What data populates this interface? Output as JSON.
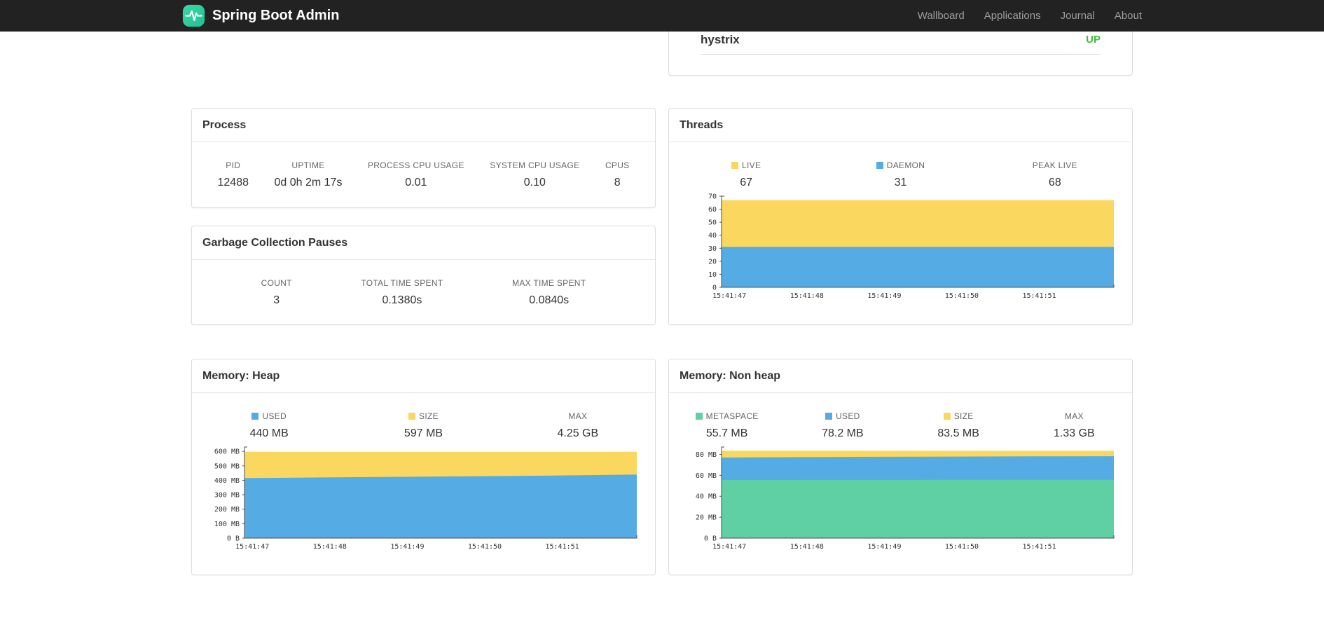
{
  "navbar": {
    "brand": "Spring Boot Admin",
    "items": [
      {
        "label": "Wallboard"
      },
      {
        "label": "Applications"
      },
      {
        "label": "Journal"
      },
      {
        "label": "About"
      }
    ]
  },
  "health": {
    "service_name": "hystrix",
    "status": "UP",
    "status_color": "#44b944"
  },
  "process": {
    "title": "Process",
    "stats": [
      {
        "label": "PID",
        "value": "12488"
      },
      {
        "label": "UPTIME",
        "value": "0d 0h 2m 17s"
      },
      {
        "label": "PROCESS CPU USAGE",
        "value": "0.01"
      },
      {
        "label": "SYSTEM CPU USAGE",
        "value": "0.10"
      },
      {
        "label": "CPUS",
        "value": "8"
      }
    ]
  },
  "gc": {
    "title": "Garbage Collection Pauses",
    "stats": [
      {
        "label": "COUNT",
        "value": "3"
      },
      {
        "label": "TOTAL TIME SPENT",
        "value": "0.1380s"
      },
      {
        "label": "MAX TIME SPENT",
        "value": "0.0840s"
      }
    ]
  },
  "threads": {
    "title": "Threads",
    "legend": [
      {
        "label": "LIVE",
        "value": "67",
        "swatch": "#fad860"
      },
      {
        "label": "DAEMON",
        "value": "31",
        "swatch": "#55abe4"
      },
      {
        "label": "PEAK LIVE",
        "value": "68"
      }
    ]
  },
  "heap": {
    "title": "Memory: Heap",
    "legend": [
      {
        "label": "USED",
        "value": "440 MB",
        "swatch": "#55abe4"
      },
      {
        "label": "SIZE",
        "value": "597 MB",
        "swatch": "#fad860"
      },
      {
        "label": "MAX",
        "value": "4.25 GB"
      }
    ]
  },
  "nonheap": {
    "title": "Memory: Non heap",
    "legend": [
      {
        "label": "METASPACE",
        "value": "55.7 MB",
        "swatch": "#5fd0a3"
      },
      {
        "label": "USED",
        "value": "78.2 MB",
        "swatch": "#55abe4"
      },
      {
        "label": "SIZE",
        "value": "83.5 MB",
        "swatch": "#fad860"
      },
      {
        "label": "MAX",
        "value": "1.33 GB"
      }
    ]
  },
  "colors": {
    "navbar_bg": "#222222",
    "brand_green": "#2fce9f",
    "status_up": "#44b944",
    "series_blue": "#55abe4",
    "series_yellow": "#fad860",
    "series_green": "#5fd0a3"
  },
  "chart_data": [
    {
      "type": "area",
      "title": "Threads",
      "x_labels": [
        "15:41:47",
        "15:41:48",
        "15:41:49",
        "15:41:50",
        "15:41:51"
      ],
      "y_max": 70,
      "grid": false,
      "legend_position": "top",
      "y_ticks": [
        {
          "v": 0,
          "label": "0"
        },
        {
          "v": 10,
          "label": "10"
        },
        {
          "v": 20,
          "label": "20"
        },
        {
          "v": 30,
          "label": "30"
        },
        {
          "v": 40,
          "label": "40"
        },
        {
          "v": 50,
          "label": "50"
        },
        {
          "v": 60,
          "label": "60"
        },
        {
          "v": 70,
          "label": "70"
        }
      ],
      "series": [
        {
          "name": "DAEMON",
          "color": "#55abe4",
          "values": [
            31,
            31,
            31,
            31,
            31,
            31
          ]
        },
        {
          "name": "LIVE",
          "color": "#fad860",
          "values": [
            67,
            67,
            67,
            67,
            67,
            67
          ]
        }
      ]
    },
    {
      "type": "area",
      "title": "Memory: Heap (MB)",
      "x_labels": [
        "15:41:47",
        "15:41:48",
        "15:41:49",
        "15:41:50",
        "15:41:51"
      ],
      "y_max": 630,
      "grid": false,
      "legend_position": "top",
      "y_ticks": [
        {
          "v": 0,
          "label": "0 B"
        },
        {
          "v": 100,
          "label": "100 MB"
        },
        {
          "v": 200,
          "label": "200 MB"
        },
        {
          "v": 300,
          "label": "300 MB"
        },
        {
          "v": 400,
          "label": "400 MB"
        },
        {
          "v": 500,
          "label": "500 MB"
        },
        {
          "v": 600,
          "label": "600 MB"
        }
      ],
      "series": [
        {
          "name": "USED",
          "color": "#55abe4",
          "values": [
            415,
            420,
            424,
            428,
            433,
            440
          ]
        },
        {
          "name": "SIZE",
          "color": "#fad860",
          "values": [
            597,
            597,
            597,
            597,
            597,
            597
          ]
        }
      ]
    },
    {
      "type": "area",
      "title": "Memory: Non heap (MB)",
      "x_labels": [
        "15:41:47",
        "15:41:48",
        "15:41:49",
        "15:41:50",
        "15:41:51"
      ],
      "y_max": 87,
      "grid": false,
      "legend_position": "top",
      "y_ticks": [
        {
          "v": 0,
          "label": "0 B"
        },
        {
          "v": 20,
          "label": "20 MB"
        },
        {
          "v": 40,
          "label": "40 MB"
        },
        {
          "v": 60,
          "label": "60 MB"
        },
        {
          "v": 80,
          "label": "80 MB"
        }
      ],
      "series": [
        {
          "name": "METASPACE",
          "color": "#5fd0a3",
          "values": [
            55.5,
            55.6,
            55.6,
            55.7,
            55.7,
            55.7
          ]
        },
        {
          "name": "USED",
          "color": "#55abe4",
          "values": [
            77,
            77.4,
            77.7,
            77.9,
            78.1,
            78.2
          ]
        },
        {
          "name": "SIZE",
          "color": "#fad860",
          "values": [
            83.5,
            83.5,
            83.5,
            83.5,
            83.5,
            83.5
          ]
        }
      ]
    }
  ]
}
